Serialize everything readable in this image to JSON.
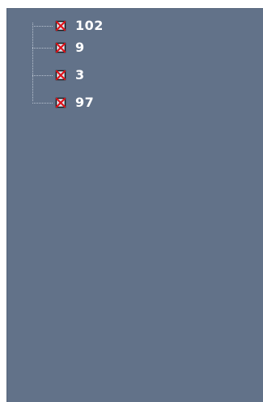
{
  "tree": {
    "items": [
      {
        "label": "102",
        "icon": "disabled-checkbox-icon"
      },
      {
        "label": "9",
        "icon": "disabled-checkbox-icon"
      },
      {
        "label": "3",
        "icon": "disabled-checkbox-icon"
      },
      {
        "label": "97",
        "icon": "disabled-checkbox-icon"
      }
    ]
  },
  "colors": {
    "pane_background": "#627289",
    "label_text": "#ffffff",
    "icon_cross": "#e0121a",
    "connector": "#b9c3d0"
  }
}
